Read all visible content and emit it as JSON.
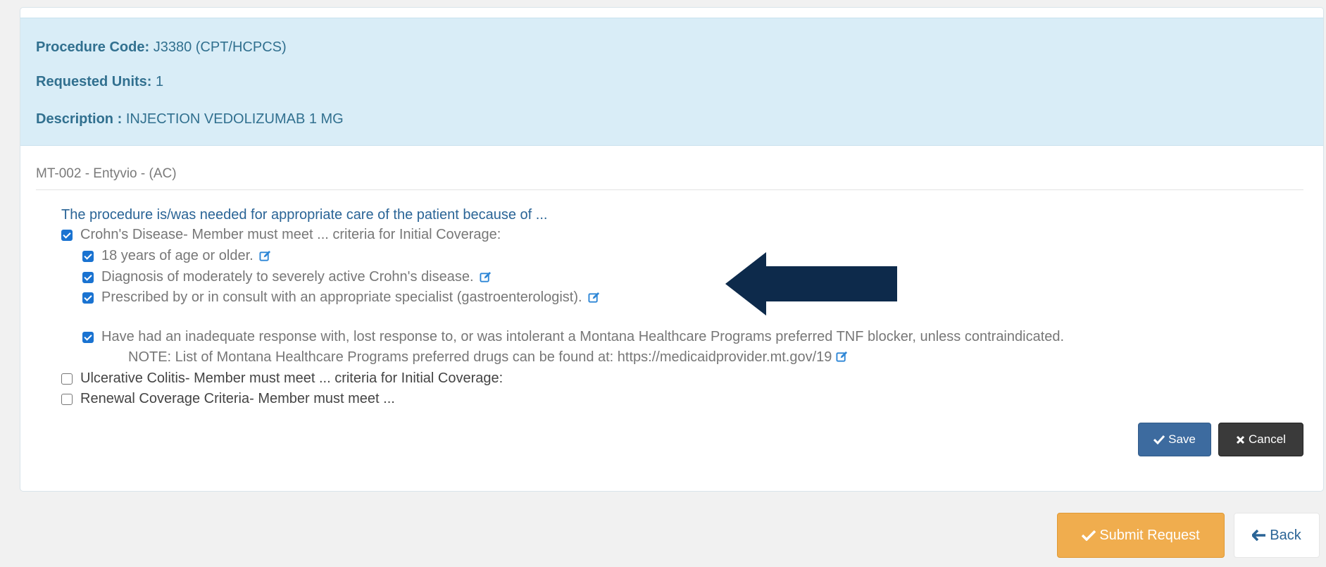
{
  "request": {
    "procedure_code_label": "Procedure Code:",
    "procedure_code_value": "J3380 (CPT/HCPCS)",
    "units_label": "Requested Units:",
    "units_value": "1",
    "description_label": "Description :",
    "description_value": "INJECTION VEDOLIZUMAB 1 MG"
  },
  "criteria": {
    "title": "MT-002 - Entyvio - (AC)",
    "question": "The procedure is/was needed for appropriate care of the patient because of ...",
    "options": [
      {
        "label": "Crohn's Disease- Member must meet ... criteria for Initial Coverage:",
        "checked": true,
        "sub": [
          {
            "label": "18 years of age or older.",
            "checked": true
          },
          {
            "label": "Diagnosis of moderately to severely active Crohn's disease.",
            "checked": true
          },
          {
            "label": "Prescribed by or in consult with an appropriate specialist (gastroenterologist).",
            "checked": true
          },
          {
            "label": "Have had an inadequate response with, lost response to, or was intolerant a Montana Healthcare Programs preferred TNF blocker, unless contraindicated.",
            "note": "NOTE: List of Montana Healthcare Programs preferred drugs can be found at: https://medicaidprovider.mt.gov/19",
            "checked": true
          }
        ]
      },
      {
        "label": "Ulcerative Colitis- Member must meet ... criteria for Initial Coverage:",
        "checked": false
      },
      {
        "label": "Renewal Coverage Criteria- Member must meet ...",
        "checked": false
      }
    ]
  },
  "buttons": {
    "save": "Save",
    "cancel": "Cancel",
    "submit": "Submit Request",
    "back": "Back"
  },
  "icons": [
    "checkbox-checked-icon",
    "checkbox-unchecked-icon",
    "edit-icon",
    "checkmark-icon",
    "x-icon",
    "left-arrow-icon",
    "annotation-arrow-icon"
  ],
  "colors": {
    "info_bg": "#d9edf7",
    "info_text": "#31708f",
    "save_button": "#3d6b9f",
    "cancel_button": "#3a3a3a",
    "submit_button": "#f0ad4e",
    "checkbox_accent": "#1a73d1",
    "annotation_arrow": "#0d2a4b"
  }
}
